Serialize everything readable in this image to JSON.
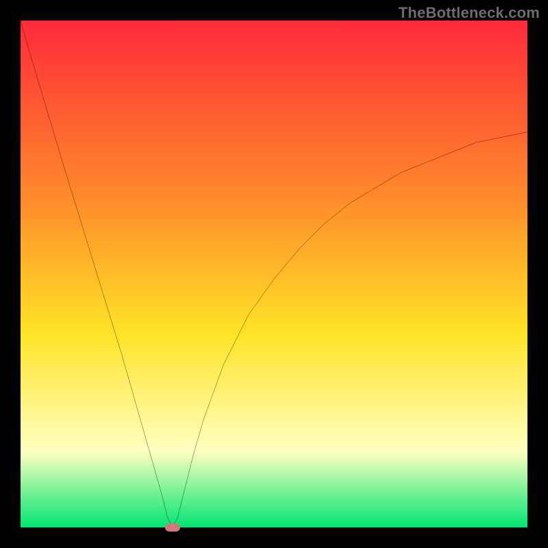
{
  "watermark": "TheBottleneck.com",
  "colors": {
    "frame": "#000000",
    "curve": "#000000",
    "marker": "#cf7a7a",
    "grad_top": "#ff2a3a",
    "grad_mid_orange": "#ff8a2a",
    "grad_mid_yellow": "#ffe327",
    "grad_pale": "#ffffc0",
    "grad_bottom": "#00e572"
  },
  "chart_data": {
    "type": "line",
    "title": "",
    "xlabel": "",
    "ylabel": "",
    "xlim": [
      0,
      100
    ],
    "ylim": [
      0,
      100
    ],
    "x": [
      0,
      2,
      5,
      8,
      12,
      16,
      20,
      24,
      26,
      28,
      29,
      30,
      31,
      32,
      34,
      36,
      40,
      45,
      50,
      55,
      60,
      65,
      70,
      75,
      80,
      85,
      90,
      95,
      100
    ],
    "values": [
      100,
      93,
      83,
      73,
      60,
      47,
      34,
      20,
      13,
      6,
      2,
      0,
      2,
      6,
      14,
      21,
      32,
      42,
      49,
      55,
      60,
      64,
      67,
      70,
      72,
      74,
      76,
      77,
      78
    ],
    "marker": {
      "x": 30,
      "y": 0
    }
  }
}
